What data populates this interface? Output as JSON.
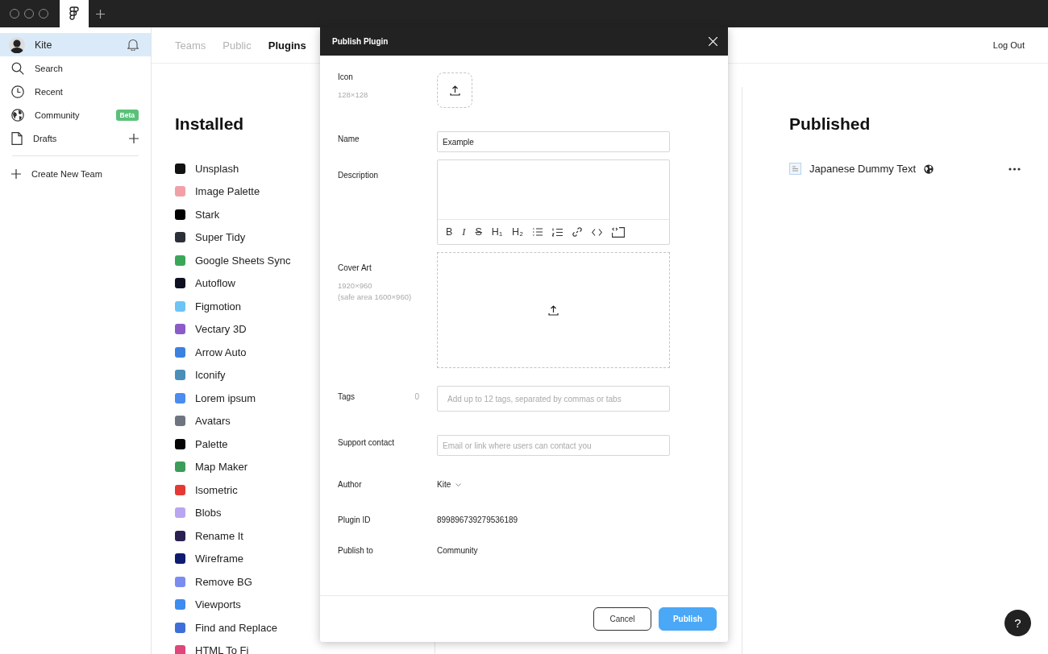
{
  "sidebar": {
    "items": [
      {
        "kind": "user",
        "label": "Kite",
        "selected": true
      },
      {
        "kind": "search",
        "label": "Search",
        "selected": false
      },
      {
        "kind": "recent",
        "label": "Recent",
        "selected": false
      },
      {
        "kind": "community",
        "label": "Community",
        "badge": "Beta",
        "selected": false
      },
      {
        "kind": "drafts",
        "label": "Drafts",
        "selected": false
      }
    ],
    "create_team": "Create New Team"
  },
  "nav": {
    "tabs": [
      {
        "label": "Teams",
        "selected": false
      },
      {
        "label": "Public",
        "selected": false
      },
      {
        "label": "Plugins",
        "selected": true
      }
    ],
    "logout": "Log Out"
  },
  "installed": {
    "title": "Installed",
    "plugins": [
      {
        "name": "Unsplash",
        "color": "#111111"
      },
      {
        "name": "Image Palette",
        "color": "#f2a0a8"
      },
      {
        "name": "Stark",
        "color": "#000000"
      },
      {
        "name": "Super Tidy",
        "color": "#2b3038"
      },
      {
        "name": "Google Sheets Sync",
        "color": "#3aa65a"
      },
      {
        "name": "Autoflow",
        "color": "#0e1022"
      },
      {
        "name": "Figmotion",
        "color": "#6ec4f5"
      },
      {
        "name": "Vectary 3D",
        "color": "#8b5cc8"
      },
      {
        "name": "Arrow Auto",
        "color": "#3b82e0"
      },
      {
        "name": "Iconify",
        "color": "#4a8fb8"
      },
      {
        "name": "Lorem ipsum",
        "color": "#4a8cf0"
      },
      {
        "name": "Avatars",
        "color": "#6f7580"
      },
      {
        "name": "Palette",
        "color": "#050505"
      },
      {
        "name": "Map Maker",
        "color": "#3d9c5a"
      },
      {
        "name": "Isometric",
        "color": "#e53935"
      },
      {
        "name": "Blobs",
        "color": "#b9a6f0"
      },
      {
        "name": "Rename It",
        "color": "#2b2150"
      },
      {
        "name": "Wireframe",
        "color": "#0f1b6e"
      },
      {
        "name": "Remove BG",
        "color": "#7b8cf0"
      },
      {
        "name": "Viewports",
        "color": "#3d8cf0"
      },
      {
        "name": "Find and Replace",
        "color": "#3e6fd8"
      },
      {
        "name": "HTML To Fi",
        "color": "#e0457b"
      }
    ]
  },
  "published": {
    "title": "Published",
    "plugins": [
      {
        "name": "Japanese Dummy Text"
      }
    ]
  },
  "modal": {
    "title": "Publish Plugin",
    "icon": {
      "label": "Icon",
      "hint": "128×128"
    },
    "name": {
      "label": "Name",
      "value": "Example"
    },
    "description": {
      "label": "Description",
      "toolbar": [
        {
          "kind": "bold",
          "label": "B"
        },
        {
          "kind": "italic",
          "label": "I"
        },
        {
          "kind": "strike",
          "label": "S"
        },
        {
          "kind": "heading",
          "label": "H₁"
        },
        {
          "kind": "heading",
          "label": "H₂"
        },
        {
          "kind": "bullets"
        },
        {
          "kind": "numbers"
        },
        {
          "kind": "link"
        },
        {
          "kind": "code"
        },
        {
          "kind": "code-block"
        }
      ]
    },
    "cover_art": {
      "label": "Cover Art",
      "hint": "1920×960",
      "hint_2": "(safe area 1600×960)"
    },
    "tags": {
      "label": "Tags",
      "count": "0",
      "placeholder": "Add up to 12 tags, separated by commas or tabs"
    },
    "support_contact": {
      "label": "Support contact",
      "placeholder": "Email or link where users can contact you"
    },
    "author": {
      "label": "Author",
      "value": "Kite"
    },
    "plugin_id": {
      "label": "Plugin ID",
      "value": "899896739279536189"
    },
    "publish_to": {
      "label": "Publish to",
      "value": "Community"
    },
    "buttons": [
      {
        "kind": "secondary",
        "label": "Cancel"
      },
      {
        "kind": "primary",
        "label": "Publish"
      }
    ]
  },
  "help": "?"
}
